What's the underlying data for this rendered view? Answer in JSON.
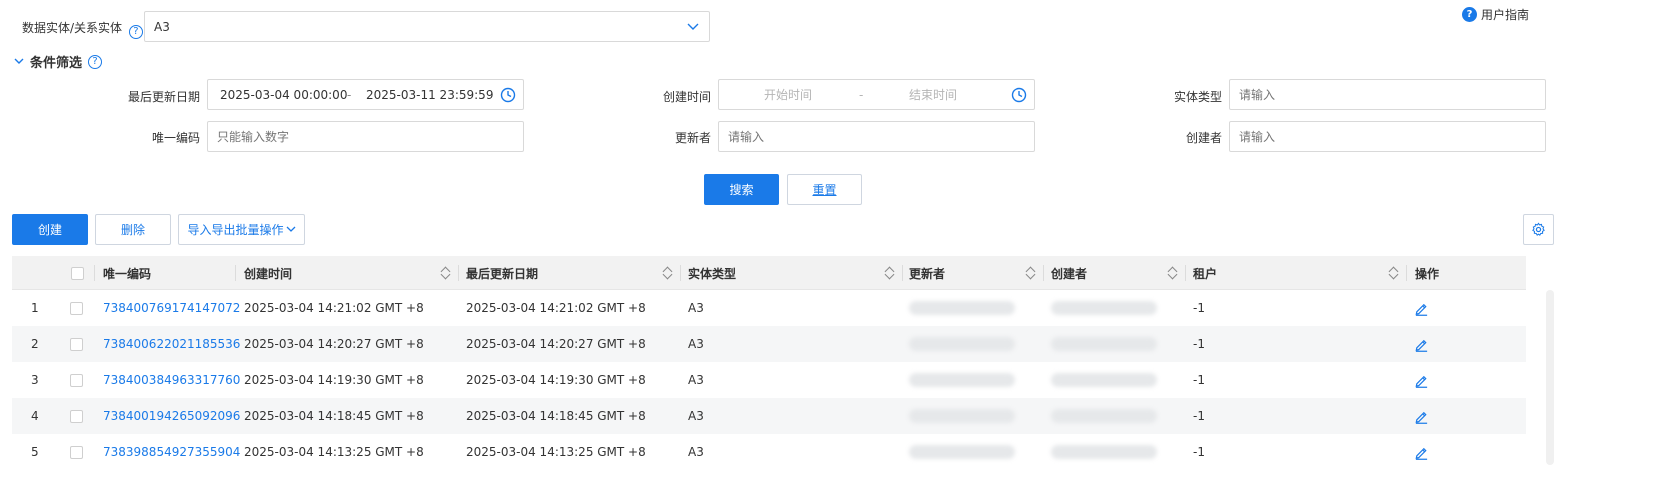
{
  "entity_select": {
    "label": "数据实体/关系实体",
    "value": "A3"
  },
  "user_guide": "用户指南",
  "filter": {
    "title": "条件筛选",
    "last_update": {
      "label": "最后更新日期",
      "start": "2025-03-04 00:00:00",
      "separator": "-",
      "end": "2025-03-11 23:59:59"
    },
    "create_time": {
      "label": "创建时间",
      "start_placeholder": "开始时间",
      "separator": "-",
      "end_placeholder": "结束时间"
    },
    "entity_type": {
      "label": "实体类型",
      "placeholder": "请输入"
    },
    "unique_code": {
      "label": "唯一编码",
      "placeholder": "只能输入数字"
    },
    "updater": {
      "label": "更新者",
      "placeholder": "请输入"
    },
    "creator": {
      "label": "创建者",
      "placeholder": "请输入"
    },
    "search_label": "搜索",
    "reset_label": "重置"
  },
  "toolbar": {
    "create_label": "创建",
    "delete_label": "删除",
    "import_export_label": "导入导出批量操作"
  },
  "table": {
    "columns": [
      "唯一编码",
      "创建时间",
      "最后更新日期",
      "实体类型",
      "更新者",
      "创建者",
      "租户",
      "操作"
    ],
    "rows": [
      {
        "index": "1",
        "code": "738400769174147072",
        "created": "2025-03-04 14:21:02 GMT +8",
        "updated": "2025-03-04 14:21:02 GMT +8",
        "type": "A3",
        "tenant": "-1"
      },
      {
        "index": "2",
        "code": "738400622021185536",
        "created": "2025-03-04 14:20:27 GMT +8",
        "updated": "2025-03-04 14:20:27 GMT +8",
        "type": "A3",
        "tenant": "-1"
      },
      {
        "index": "3",
        "code": "738400384963317760",
        "created": "2025-03-04 14:19:30 GMT +8",
        "updated": "2025-03-04 14:19:30 GMT +8",
        "type": "A3",
        "tenant": "-1"
      },
      {
        "index": "4",
        "code": "738400194265092096",
        "created": "2025-03-04 14:18:45 GMT +8",
        "updated": "2025-03-04 14:18:45 GMT +8",
        "type": "A3",
        "tenant": "-1"
      },
      {
        "index": "5",
        "code": "738398854927355904",
        "created": "2025-03-04 14:13:25 GMT +8",
        "updated": "2025-03-04 14:13:25 GMT +8",
        "type": "A3",
        "tenant": "-1"
      }
    ]
  },
  "icons": {
    "help": "question-circle-icon",
    "dropdown": "chevron-down-icon",
    "clock": "clock-icon",
    "settings": "gear-icon",
    "edit": "pencil-icon"
  },
  "colors": {
    "accent": "#1a7ae8",
    "header_bg": "#f2f2f2",
    "stripe_bg": "#f5f6f7"
  }
}
